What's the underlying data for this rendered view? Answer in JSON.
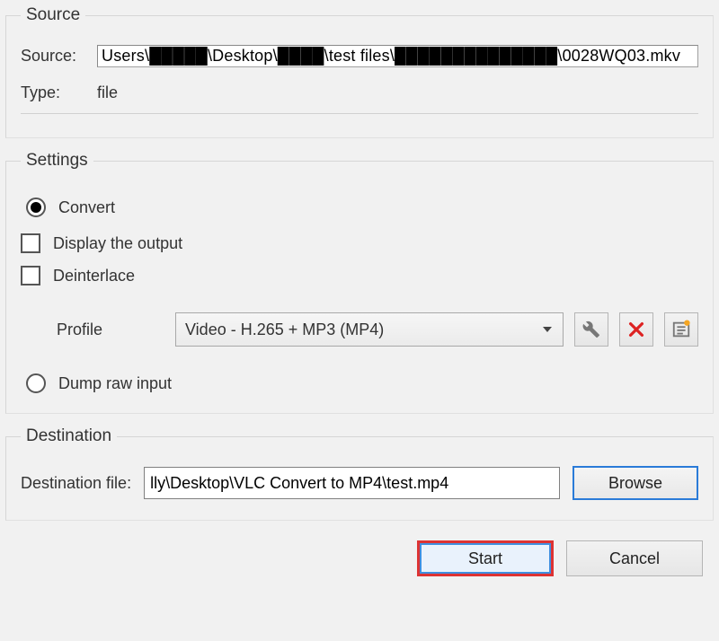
{
  "source": {
    "legend": "Source",
    "label": "Source:",
    "value": "Users\\█████\\Desktop\\████\\test files\\██████████████\\0028WQ03.mkv",
    "type_label": "Type:",
    "type_value": "file"
  },
  "settings": {
    "legend": "Settings",
    "convert_label": "Convert",
    "convert_checked": true,
    "display_output_label": "Display the output",
    "display_output_checked": false,
    "deinterlace_label": "Deinterlace",
    "deinterlace_checked": false,
    "profile_label": "Profile",
    "profile_value": "Video - H.265 + MP3 (MP4)",
    "dump_raw_label": "Dump raw input",
    "dump_raw_checked": false
  },
  "destination": {
    "legend": "Destination",
    "label": "Destination file:",
    "value": "lly\\Desktop\\VLC Convert to MP4\\test.mp4",
    "browse_label": "Browse"
  },
  "buttons": {
    "start": "Start",
    "cancel": "Cancel"
  },
  "icons": {
    "wrench": "wrench-icon",
    "delete": "delete-icon",
    "new_profile": "new-profile-icon"
  }
}
